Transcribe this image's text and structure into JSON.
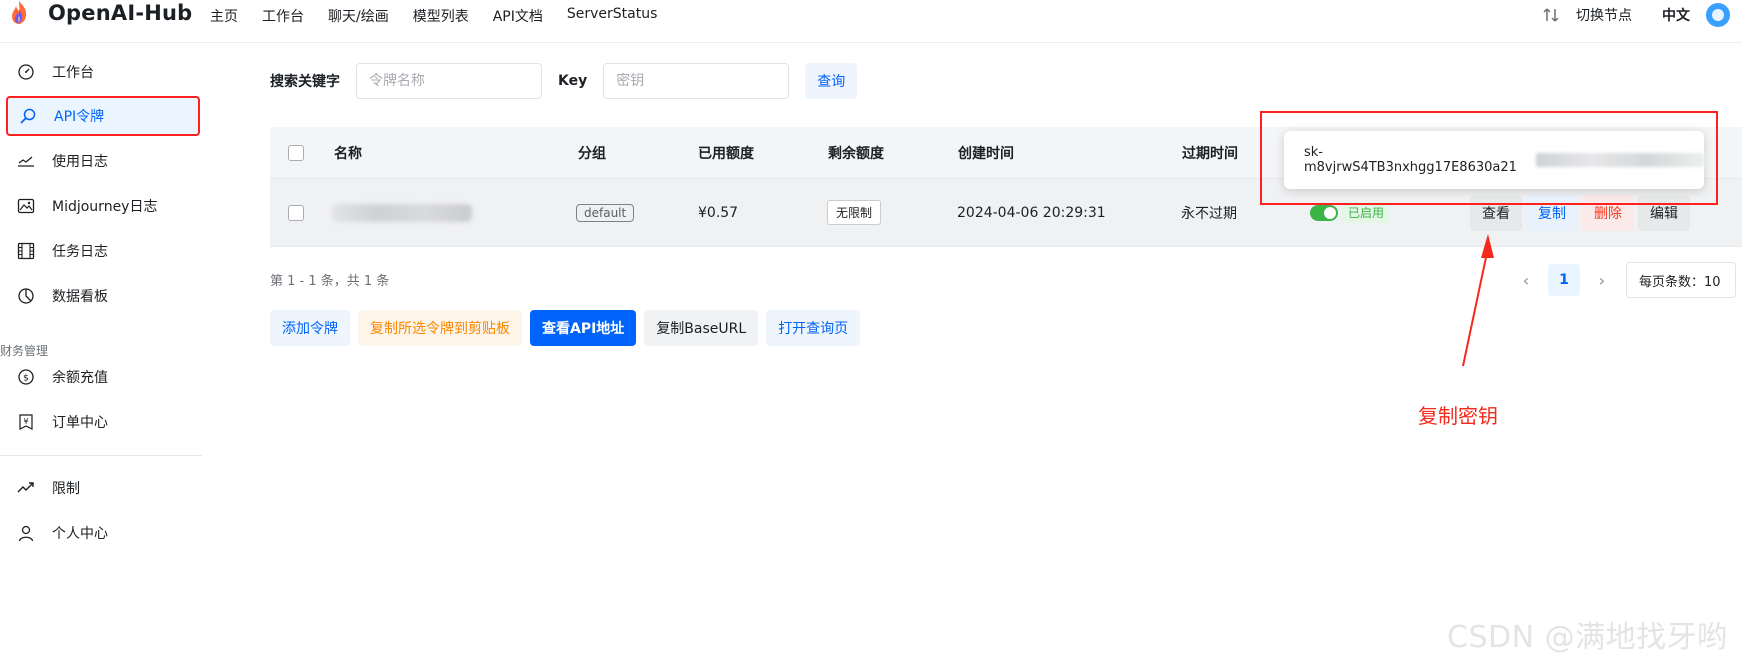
{
  "header": {
    "brand": "OpenAI-Hub",
    "nav": [
      "主页",
      "工作台",
      "聊天/绘画",
      "模型列表",
      "API文档",
      "ServerStatus"
    ],
    "switch_node": "切换节点",
    "language": "中文"
  },
  "sidebar": {
    "items": [
      {
        "label": "工作台",
        "icon": "dashboard-icon"
      },
      {
        "label": "API令牌",
        "icon": "search-key-icon"
      },
      {
        "label": "使用日志",
        "icon": "log-icon"
      },
      {
        "label": "Midjourney日志",
        "icon": "image-icon"
      },
      {
        "label": "任务日志",
        "icon": "film-icon"
      },
      {
        "label": "数据看板",
        "icon": "pie-chart-icon"
      }
    ],
    "group_label": "财务管理",
    "finance_items": [
      {
        "label": "余额充值",
        "icon": "dollar-icon"
      },
      {
        "label": "订单中心",
        "icon": "yen-icon"
      }
    ],
    "bottom_items": [
      {
        "label": "限制",
        "icon": "trend-icon"
      },
      {
        "label": "个人中心",
        "icon": "user-icon"
      }
    ]
  },
  "search": {
    "keyword_label": "搜索关键字",
    "keyword_placeholder": "令牌名称",
    "key_label": "Key",
    "key_placeholder": "密钥",
    "query_button": "查询"
  },
  "table": {
    "columns": [
      "名称",
      "分组",
      "已用额度",
      "剩余额度",
      "创建时间",
      "过期时间"
    ],
    "rows": [
      {
        "group": "default",
        "used": "¥0.57",
        "remaining": "无限制",
        "created": "2024-04-06 20:29:31",
        "expires": "永不过期",
        "status": "已启用",
        "actions": [
          "查看",
          "复制",
          "删除",
          "编辑"
        ]
      }
    ]
  },
  "popover": {
    "key_visible": "sk-m8vjrwS4TB3nxhgg17E8630a21"
  },
  "pagination": {
    "info": "第 1 - 1 条，共 1 条",
    "current_page": "1",
    "page_size": "每页条数：10"
  },
  "buttons": {
    "add_token": "添加令牌",
    "copy_selected": "复制所选令牌到剪贴板",
    "view_api": "查看API地址",
    "copy_base": "复制BaseURL",
    "open_query": "打开查询页"
  },
  "annotation": {
    "text": "复制密钥"
  },
  "watermark": "CSDN @满地找牙哟",
  "colors": {
    "primary": "#0064fa",
    "danger": "#f93920",
    "success": "#3bb346",
    "annotation": "#ff2020"
  }
}
